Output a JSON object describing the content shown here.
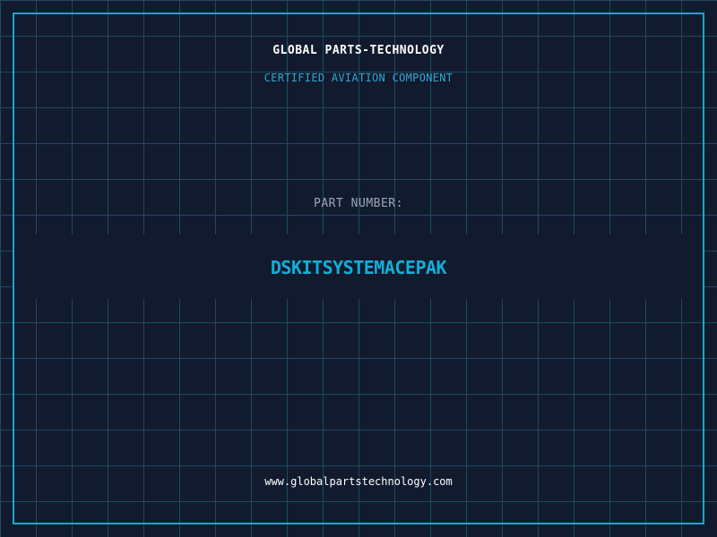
{
  "header": {
    "company": "GLOBAL PARTS-TECHNOLOGY",
    "subtitle": "CERTIFIED AVIATION COMPONENT"
  },
  "part": {
    "label": "PART NUMBER:",
    "number": "DSKITSYSTEMACEPAK"
  },
  "footer": {
    "url": "www.globalpartstechnology.com"
  },
  "colors": {
    "background": "#121a2e",
    "grid": "#1d4a63",
    "accent": "#12aed8",
    "frame": "#19a7cf"
  }
}
